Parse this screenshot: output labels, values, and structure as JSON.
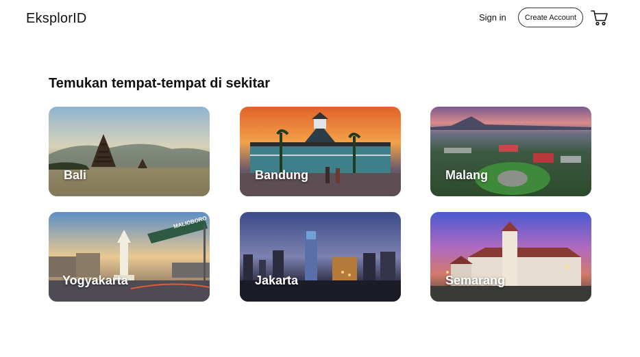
{
  "header": {
    "logo": "EksplorID",
    "sign_in": "Sign in",
    "create_account": "Create Account",
    "cart_icon": "cart-icon"
  },
  "main": {
    "title": "Temukan tempat-tempat di sekitar",
    "destinations": [
      {
        "name": "Bali"
      },
      {
        "name": "Bandung"
      },
      {
        "name": "Malang"
      },
      {
        "name": "Yogyakarta"
      },
      {
        "name": "Jakarta"
      },
      {
        "name": "Semarang"
      }
    ],
    "sign_text": "MALIOBORO"
  },
  "colors": {
    "text": "#111111",
    "background": "#ffffff"
  }
}
